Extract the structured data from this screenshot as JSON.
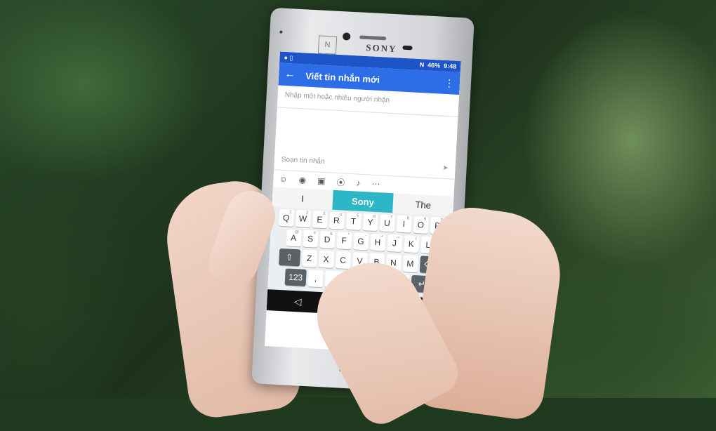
{
  "phone": {
    "brand": "SONY",
    "nfc_label": "N"
  },
  "status_bar": {
    "battery": "46%",
    "time": "9:48"
  },
  "app_bar": {
    "back_icon": "arrow-back-icon",
    "title": "Viết tin nhắn mới",
    "menu_icon": "more-vert-icon"
  },
  "recipient": {
    "placeholder": "Nhập một hoặc nhiều người nhận"
  },
  "compose": {
    "placeholder": "Soạn tin nhắn",
    "send_icon": "send-icon"
  },
  "attachments": [
    "sticker-icon",
    "camera-icon",
    "image-icon",
    "location-icon",
    "microphone-icon",
    "more-icon"
  ],
  "suggestions": [
    "I",
    "Sony",
    "The"
  ],
  "keyboard": {
    "row1": [
      {
        "k": "Q",
        "n": "1"
      },
      {
        "k": "W",
        "n": "2"
      },
      {
        "k": "E",
        "n": "3"
      },
      {
        "k": "R",
        "n": "4"
      },
      {
        "k": "T",
        "n": "5"
      },
      {
        "k": "Y",
        "n": "6"
      },
      {
        "k": "U",
        "n": "7"
      },
      {
        "k": "I",
        "n": "8"
      },
      {
        "k": "O",
        "n": "9"
      },
      {
        "k": "P",
        "n": "0"
      }
    ],
    "row2": [
      {
        "k": "A",
        "n": "@"
      },
      {
        "k": "S",
        "n": "#"
      },
      {
        "k": "D",
        "n": "&"
      },
      {
        "k": "F",
        "n": "*"
      },
      {
        "k": "G",
        "n": "-"
      },
      {
        "k": "H",
        "n": "+"
      },
      {
        "k": "J",
        "n": "="
      },
      {
        "k": "K",
        "n": "("
      },
      {
        "k": "L",
        "n": ")"
      }
    ],
    "row3": [
      {
        "k": "Z",
        "n": ""
      },
      {
        "k": "X",
        "n": ""
      },
      {
        "k": "C",
        "n": ""
      },
      {
        "k": "V",
        "n": ""
      },
      {
        "k": "B",
        "n": ""
      },
      {
        "k": "N",
        "n": ""
      },
      {
        "k": "M",
        "n": ""
      }
    ],
    "num_key": "123",
    "comma_key": ","
  }
}
